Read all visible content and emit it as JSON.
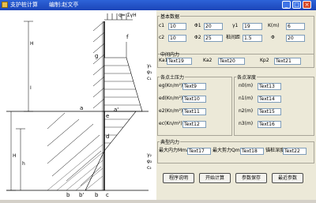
{
  "window": {
    "title": "支护桩计算",
    "author": "编制:赵文亭"
  },
  "drawing": {
    "load_label": "q= ΣγH",
    "left_dims": [
      "H",
      "I",
      "H",
      "h",
      "h",
      "h"
    ],
    "points": {
      "a": "a",
      "b": "b",
      "b_prime": "b'",
      "b2": "b",
      "c": "c",
      "d": "d",
      "e": "e",
      "f": "f",
      "g": "g",
      "a_prime": "a'"
    },
    "upper_labels": [
      "γ₁",
      "φ₁",
      "c₁"
    ],
    "lower_labels": [
      "γ₂",
      "φ₂",
      "c₂"
    ]
  },
  "basic": {
    "legend": "基本数据",
    "c1_label": "c1",
    "c1": "10",
    "phi1_label": "Φ1",
    "phi1": "20",
    "gamma1_label": "γ1",
    "gamma1": "19",
    "k_label": "K(m)",
    "k": "6",
    "c2_label": "c2",
    "c2": "10",
    "phi2_label": "Φ2",
    "phi2": "25",
    "spacing_label": "桩间距",
    "spacing": "1.5",
    "phi_label": "Φ",
    "phi": "20"
  },
  "intermediate": {
    "legend": "中间内力",
    "ka1_label": "Ka1",
    "ka1": "Text19",
    "ka2_label": "Ka2",
    "ka2": "Text20",
    "kp2_label": "Kp2",
    "kp2": "Text21"
  },
  "earth_pressure": {
    "legend": "各点土压力",
    "rows": [
      {
        "label": "eg(Kn/m²)",
        "value": "Text9"
      },
      {
        "label": "ed(Kn/m²)",
        "value": "Text10"
      },
      {
        "label": "e2(Kn/m²)",
        "value": "Text11"
      },
      {
        "label": "ec(Kn/m²)",
        "value": "Text12"
      }
    ]
  },
  "depth": {
    "legend": "各点深度",
    "rows": [
      {
        "label": "n0(m)",
        "value": "Text13"
      },
      {
        "label": "n1(m)",
        "value": "Text14"
      },
      {
        "label": "n2(m)",
        "value": "Text15"
      },
      {
        "label": "n3(m)",
        "value": "Text16"
      }
    ]
  },
  "internal_force": {
    "legend": "典型内力",
    "mmax_label": "最大内力Mmax",
    "mmax": "Text17",
    "qmax_label": "最大剪力Qmax",
    "qmax": "Text18",
    "embed_label": "锚桩深度",
    "embed": "Text22"
  },
  "buttons": {
    "help": "程序说明",
    "calc": "开始计算",
    "save": "参数保存",
    "recent": "最近参数"
  }
}
